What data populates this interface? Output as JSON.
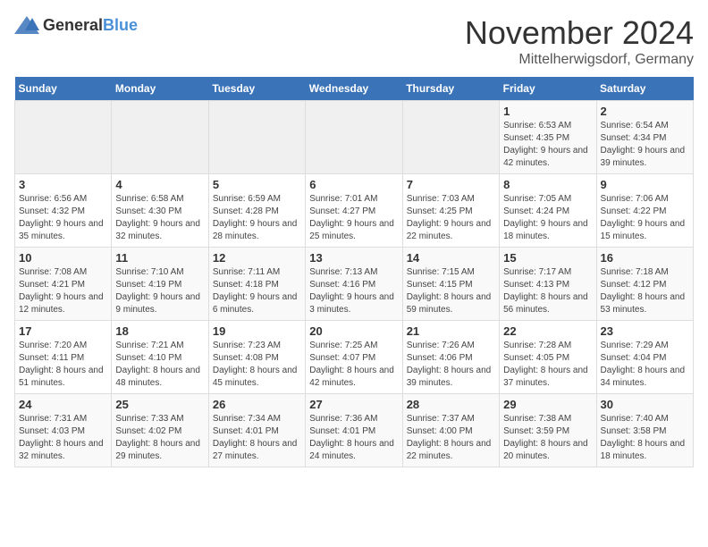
{
  "header": {
    "logo_general": "General",
    "logo_blue": "Blue",
    "month": "November 2024",
    "location": "Mittelherwigsdorf, Germany"
  },
  "weekdays": [
    "Sunday",
    "Monday",
    "Tuesday",
    "Wednesday",
    "Thursday",
    "Friday",
    "Saturday"
  ],
  "weeks": [
    [
      {
        "day": "",
        "info": ""
      },
      {
        "day": "",
        "info": ""
      },
      {
        "day": "",
        "info": ""
      },
      {
        "day": "",
        "info": ""
      },
      {
        "day": "",
        "info": ""
      },
      {
        "day": "1",
        "info": "Sunrise: 6:53 AM\nSunset: 4:35 PM\nDaylight: 9 hours and 42 minutes."
      },
      {
        "day": "2",
        "info": "Sunrise: 6:54 AM\nSunset: 4:34 PM\nDaylight: 9 hours and 39 minutes."
      }
    ],
    [
      {
        "day": "3",
        "info": "Sunrise: 6:56 AM\nSunset: 4:32 PM\nDaylight: 9 hours and 35 minutes."
      },
      {
        "day": "4",
        "info": "Sunrise: 6:58 AM\nSunset: 4:30 PM\nDaylight: 9 hours and 32 minutes."
      },
      {
        "day": "5",
        "info": "Sunrise: 6:59 AM\nSunset: 4:28 PM\nDaylight: 9 hours and 28 minutes."
      },
      {
        "day": "6",
        "info": "Sunrise: 7:01 AM\nSunset: 4:27 PM\nDaylight: 9 hours and 25 minutes."
      },
      {
        "day": "7",
        "info": "Sunrise: 7:03 AM\nSunset: 4:25 PM\nDaylight: 9 hours and 22 minutes."
      },
      {
        "day": "8",
        "info": "Sunrise: 7:05 AM\nSunset: 4:24 PM\nDaylight: 9 hours and 18 minutes."
      },
      {
        "day": "9",
        "info": "Sunrise: 7:06 AM\nSunset: 4:22 PM\nDaylight: 9 hours and 15 minutes."
      }
    ],
    [
      {
        "day": "10",
        "info": "Sunrise: 7:08 AM\nSunset: 4:21 PM\nDaylight: 9 hours and 12 minutes."
      },
      {
        "day": "11",
        "info": "Sunrise: 7:10 AM\nSunset: 4:19 PM\nDaylight: 9 hours and 9 minutes."
      },
      {
        "day": "12",
        "info": "Sunrise: 7:11 AM\nSunset: 4:18 PM\nDaylight: 9 hours and 6 minutes."
      },
      {
        "day": "13",
        "info": "Sunrise: 7:13 AM\nSunset: 4:16 PM\nDaylight: 9 hours and 3 minutes."
      },
      {
        "day": "14",
        "info": "Sunrise: 7:15 AM\nSunset: 4:15 PM\nDaylight: 8 hours and 59 minutes."
      },
      {
        "day": "15",
        "info": "Sunrise: 7:17 AM\nSunset: 4:13 PM\nDaylight: 8 hours and 56 minutes."
      },
      {
        "day": "16",
        "info": "Sunrise: 7:18 AM\nSunset: 4:12 PM\nDaylight: 8 hours and 53 minutes."
      }
    ],
    [
      {
        "day": "17",
        "info": "Sunrise: 7:20 AM\nSunset: 4:11 PM\nDaylight: 8 hours and 51 minutes."
      },
      {
        "day": "18",
        "info": "Sunrise: 7:21 AM\nSunset: 4:10 PM\nDaylight: 8 hours and 48 minutes."
      },
      {
        "day": "19",
        "info": "Sunrise: 7:23 AM\nSunset: 4:08 PM\nDaylight: 8 hours and 45 minutes."
      },
      {
        "day": "20",
        "info": "Sunrise: 7:25 AM\nSunset: 4:07 PM\nDaylight: 8 hours and 42 minutes."
      },
      {
        "day": "21",
        "info": "Sunrise: 7:26 AM\nSunset: 4:06 PM\nDaylight: 8 hours and 39 minutes."
      },
      {
        "day": "22",
        "info": "Sunrise: 7:28 AM\nSunset: 4:05 PM\nDaylight: 8 hours and 37 minutes."
      },
      {
        "day": "23",
        "info": "Sunrise: 7:29 AM\nSunset: 4:04 PM\nDaylight: 8 hours and 34 minutes."
      }
    ],
    [
      {
        "day": "24",
        "info": "Sunrise: 7:31 AM\nSunset: 4:03 PM\nDaylight: 8 hours and 32 minutes."
      },
      {
        "day": "25",
        "info": "Sunrise: 7:33 AM\nSunset: 4:02 PM\nDaylight: 8 hours and 29 minutes."
      },
      {
        "day": "26",
        "info": "Sunrise: 7:34 AM\nSunset: 4:01 PM\nDaylight: 8 hours and 27 minutes."
      },
      {
        "day": "27",
        "info": "Sunrise: 7:36 AM\nSunset: 4:01 PM\nDaylight: 8 hours and 24 minutes."
      },
      {
        "day": "28",
        "info": "Sunrise: 7:37 AM\nSunset: 4:00 PM\nDaylight: 8 hours and 22 minutes."
      },
      {
        "day": "29",
        "info": "Sunrise: 7:38 AM\nSunset: 3:59 PM\nDaylight: 8 hours and 20 minutes."
      },
      {
        "day": "30",
        "info": "Sunrise: 7:40 AM\nSunset: 3:58 PM\nDaylight: 8 hours and 18 minutes."
      }
    ]
  ]
}
